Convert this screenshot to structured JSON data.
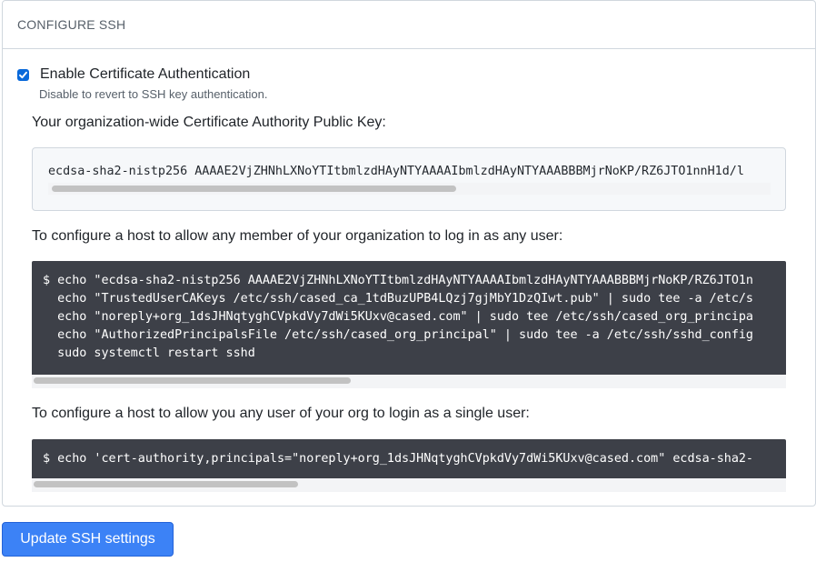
{
  "panel": {
    "title": "CONFIGURE SSH"
  },
  "cert_auth": {
    "checked": true,
    "label": "Enable Certificate Authentication",
    "help": "Disable to revert to SSH key authentication."
  },
  "ca_key": {
    "label": "Your organization-wide Certificate Authority Public Key:",
    "value": "ecdsa-sha2-nistp256 AAAAE2VjZHNhLXNoYTItbmlzdHAyNTYAAAAIbmlzdHAyNTYAAABBBMjrNoKP/RZ6JTO1nnH1d/l",
    "scroll_fraction": 0.56
  },
  "any_user": {
    "label": "To configure a host to allow any member of your organization to log in as any user:",
    "lines": [
      "$ echo \"ecdsa-sha2-nistp256 AAAAE2VjZHNhLXNoYTItbmlzdHAyNTYAAAAIbmlzdHAyNTYAAABBBMjrNoKP/RZ6JTO1n",
      "  echo \"TrustedUserCAKeys /etc/ssh/cased_ca_1tdBuzUPB4LQzj7gjMbY1DzQIwt.pub\" | sudo tee -a /etc/s",
      "  echo \"noreply+org_1dsJHNqtyghCVpkdVy7dWi5KUxv@cased.com\" | sudo tee /etc/ssh/cased_org_principa",
      "  echo \"AuthorizedPrincipalsFile /etc/ssh/cased_org_principal\" | sudo tee -a /etc/ssh/sshd_config",
      "  sudo systemctl restart sshd"
    ],
    "scroll_fraction": 0.42
  },
  "single_user": {
    "label": "To configure a host to allow you any user of your org to login as a single user:",
    "line": "$ echo 'cert-authority,principals=\"noreply+org_1dsJHNqtyghCVpkdVy7dWi5KUxv@cased.com\" ecdsa-sha2-",
    "scroll_fraction": 0.35
  },
  "submit": {
    "label": "Update SSH settings"
  },
  "colors": {
    "accent": "#3c82f6",
    "terminal_bg": "#3d4048",
    "checkbox": "#0969da"
  }
}
